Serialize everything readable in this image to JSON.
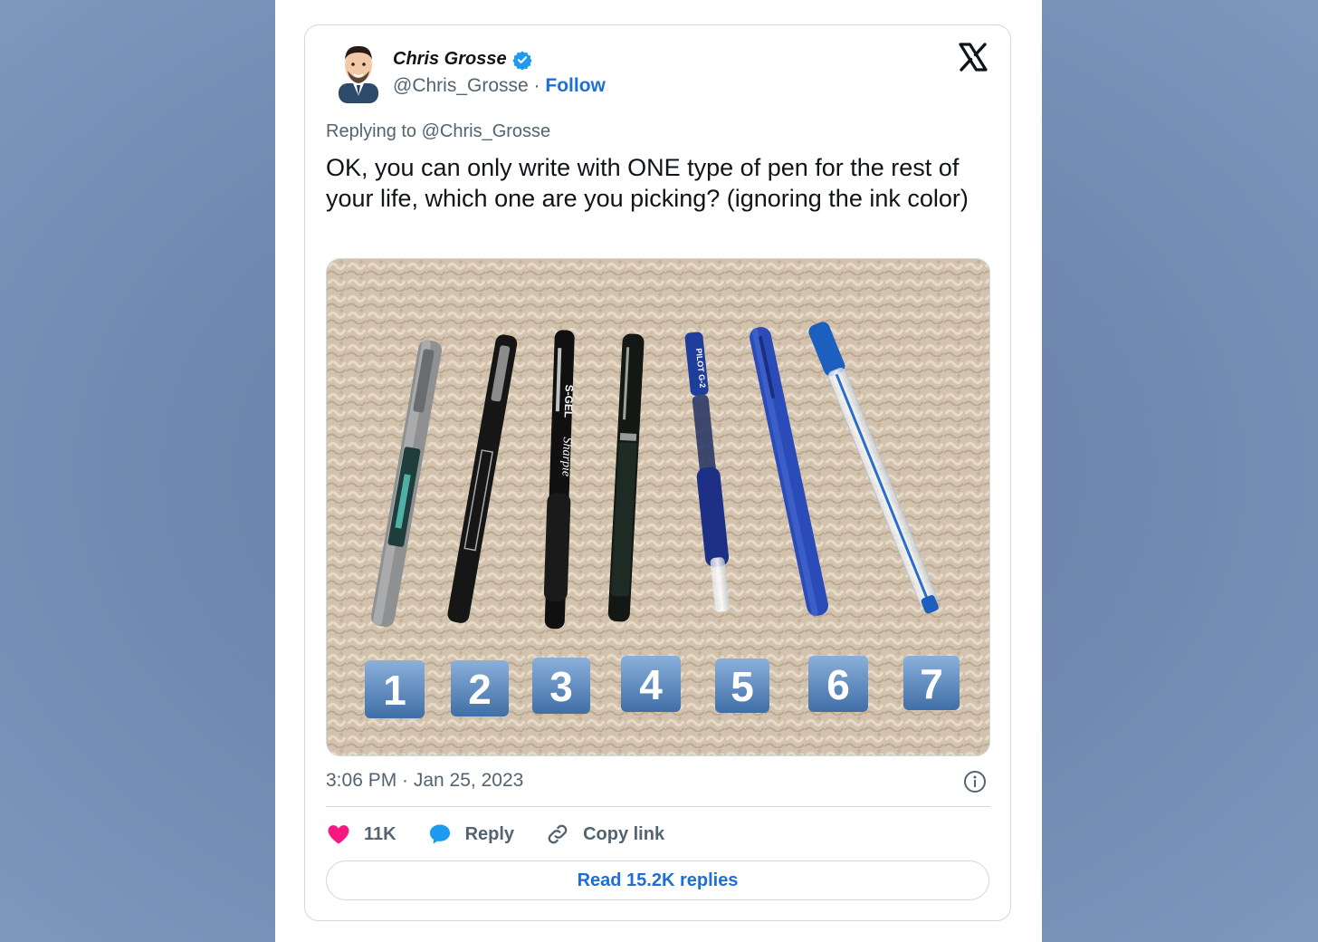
{
  "author": {
    "name": "Chris Grosse",
    "handle": "@Chris_Grosse",
    "separator": "·",
    "follow_label": "Follow"
  },
  "replying_to": "Replying to @Chris_Grosse",
  "tweet": {
    "text": "OK, you can only write with ONE type of pen for the rest of your life, which one are you picking? (ignoring the ink color)",
    "timestamp": "3:06 PM · Jan 25, 2023"
  },
  "image": {
    "badges": [
      "1",
      "2",
      "3",
      "4",
      "5",
      "6",
      "7"
    ],
    "pen_labels": {
      "pen3_top": "S-GEL",
      "pen3_brand": "Sharpie",
      "pen5": "PILOT G-2"
    }
  },
  "actions": {
    "like_count": "11K",
    "reply_label": "Reply",
    "copy_label": "Copy link",
    "read_replies_label": "Read 15.2K replies"
  },
  "colors": {
    "like": "#f91880",
    "reply": "#1d9bf0",
    "link": "#1d6fd6",
    "verified": "#1d9bf0"
  },
  "icons": [
    "avatar",
    "verified-badge-icon",
    "x-logo-icon",
    "info-icon",
    "heart-icon",
    "reply-bubble-icon",
    "link-icon"
  ]
}
